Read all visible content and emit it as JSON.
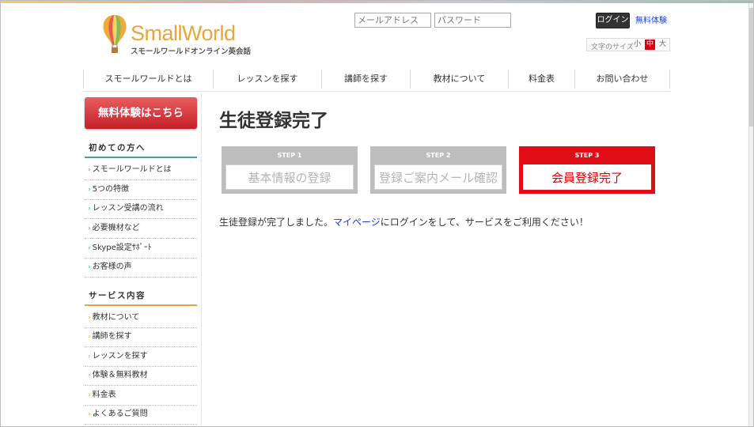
{
  "header": {
    "logo_text": "SmallWorld",
    "logo_tagline": "スモールワールドオンライン英会話",
    "email_placeholder": "メールアドレス",
    "password_placeholder": "パスワード",
    "login_label": "ログイン",
    "free_trial_link": "無料体験",
    "font_size_label": "文字のサイズ",
    "font_sizes": [
      "小",
      "中",
      "大"
    ],
    "font_size_selected": "中"
  },
  "nav": {
    "items": [
      "スモールワールドとは",
      "レッスンを探す",
      "講師を探す",
      "教材について",
      "料金表",
      "お問い合わせ"
    ]
  },
  "sidebar": {
    "trial_button": "無料体験はこちら",
    "sections": [
      {
        "heading": "初めての方へ",
        "items": [
          "スモールワールドとは",
          "5つの特徴",
          "レッスン受講の流れ",
          "必要機材など",
          "Skype設定ｻﾎﾟｰﾄ",
          "お客様の声"
        ]
      },
      {
        "heading": "サービス内容",
        "items": [
          "教材について",
          "講師を探す",
          "レッスンを探す",
          "体験＆無料教材",
          "料金表",
          "よくあるご質問"
        ]
      }
    ],
    "arrow_glyph": "›"
  },
  "main": {
    "title": "生徒登録完了",
    "steps": [
      {
        "num": "STEP 1",
        "label": "基本情報の登録",
        "active": false
      },
      {
        "num": "STEP 2",
        "label": "登録ご案内メール確認",
        "active": false
      },
      {
        "num": "STEP 3",
        "label": "会員登録完了",
        "active": true
      }
    ],
    "message_before": "生徒登録が完了しました。",
    "message_link": "マイページ",
    "message_after": "にログインをして、サービスをご利用ください！"
  },
  "colors": {
    "accent_red": "#e00c16",
    "logo_orange": "#e8a63a",
    "teal_line": "#3aa7a0",
    "link_blue": "#1a3fd0"
  },
  "icons": {
    "logo": "hot-air-balloon-icon"
  }
}
